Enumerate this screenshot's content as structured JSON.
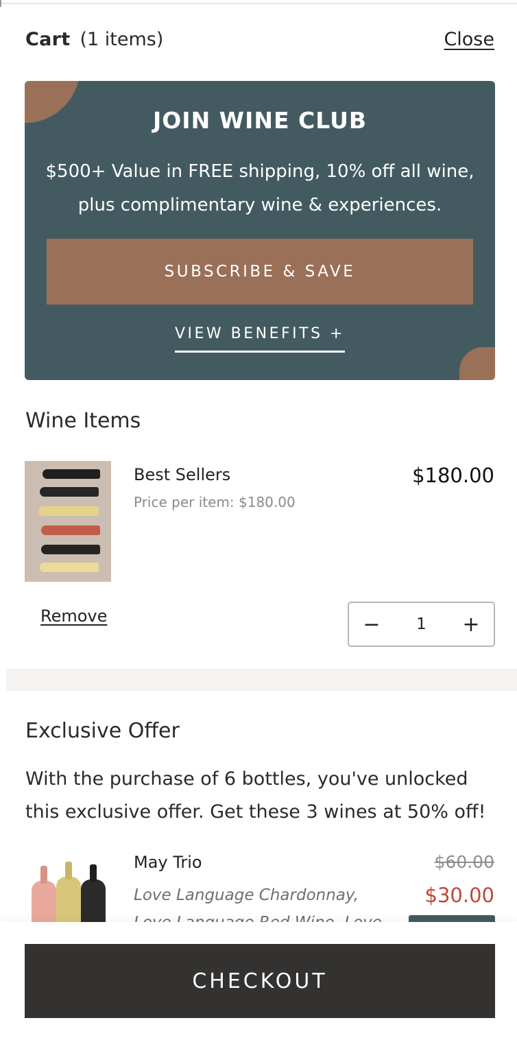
{
  "header": {
    "cart_label": "Cart",
    "item_count": "(1 items)",
    "close_label": "Close"
  },
  "wine_club": {
    "title": "JOIN WINE CLUB",
    "description": "$500+ Value in FREE shipping, 10% off all wine, plus complimentary wine & experiences.",
    "subscribe_label": "SUBSCRIBE & SAVE",
    "benefits_label": "VIEW BENEFITS +"
  },
  "wine_items": {
    "heading": "Wine Items",
    "items": [
      {
        "name": "Best Sellers",
        "unit_price": "Price per item: $180.00",
        "total": "$180.00",
        "quantity": "1",
        "remove_label": "Remove"
      }
    ]
  },
  "exclusive_offer": {
    "heading": "Exclusive Offer",
    "description": "With the purchase of 6 bottles, you've unlocked this exclusive offer. Get these 3 wines at 50% off!",
    "product": {
      "name": "May Trio",
      "subtitle": "Love Language Chardonnay, Love Language Red Wine, Love",
      "original_price": "$60.00",
      "sale_price": "$30.00"
    }
  },
  "footer": {
    "checkout_label": "CHECKOUT"
  },
  "colors": {
    "club_bg": "#435b60",
    "accent_copper": "#9b7058",
    "sale_red": "#c0473a",
    "checkout_bg": "#333231"
  },
  "icons": {
    "decrement": "minus-icon",
    "increment": "plus-icon"
  }
}
